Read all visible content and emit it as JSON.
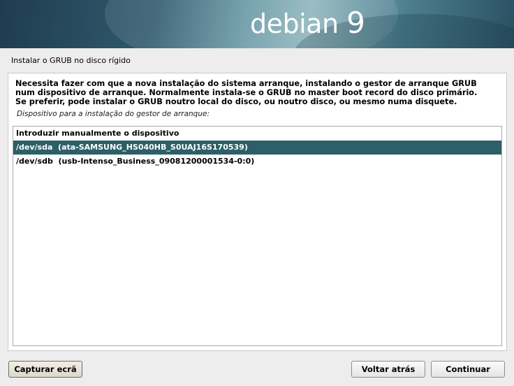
{
  "banner": {
    "brand_name": "debian",
    "brand_version": "9"
  },
  "step_title": "Instalar o GRUB no disco rígido",
  "description_lines": [
    "Necessita fazer com que a nova instalação do sistema arranque, instalando o gestor de arranque GRUB",
    "num dispositivo de arranque. Normalmente instala-se o GRUB no master boot record do disco primário.",
    "Se preferir, pode instalar o GRUB noutro local do disco, ou noutro disco, ou mesmo numa disquete."
  ],
  "question": "Dispositivo para a instalação do gestor de arranque:",
  "options": [
    {
      "label": "Introduzir manualmente o dispositivo",
      "selected": false
    },
    {
      "label": "/dev/sda  (ata-SAMSUNG_HS040HB_S0UAJ16S170539)",
      "selected": true
    },
    {
      "label": "/dev/sdb  (usb-Intenso_Business_09081200001534-0:0)",
      "selected": false
    }
  ],
  "buttons": {
    "screenshot": "Capturar ecrã",
    "back": "Voltar atrás",
    "continue": "Continuar"
  },
  "colors": {
    "selection": "#2c5f68",
    "background": "#ededed"
  }
}
